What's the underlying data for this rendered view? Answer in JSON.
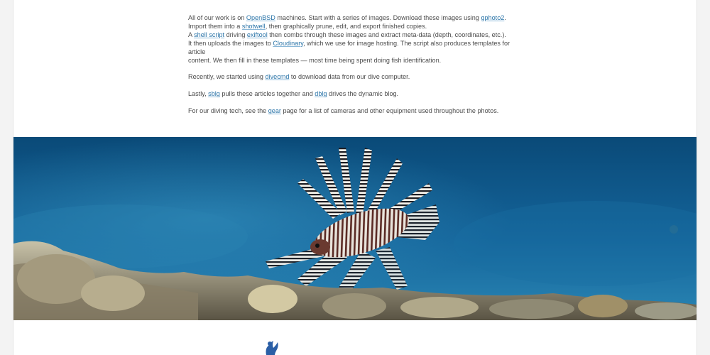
{
  "article": {
    "p1": {
      "l1": {
        "t1": "All of our work is on ",
        "link1": "OpenBSD",
        "t2": " machines. Start with a series of images. Download these images using ",
        "link2": "gphoto2",
        "t3": "."
      },
      "l2": {
        "t1": "Import them into a ",
        "link1": "shotwell",
        "t2": ", then graphically prune, edit, and export finished copies."
      },
      "l3": {
        "t1": "A ",
        "link1": "shell script",
        "t2": " driving ",
        "link2": "exiftool",
        "t3": " then combs through these images and extract meta-data (depth, coordinates, etc.)."
      },
      "l4": {
        "t1": "It then uploads the images to ",
        "link1": "Cloudinary",
        "t2": ", which we use for image hosting. The script also produces templates for article"
      },
      "l5": {
        "t1": "content. We then fill in these templates — most time being spent doing fish identification."
      }
    },
    "p2": {
      "t1": "Recently, we started using ",
      "link1": "divecmd",
      "t2": " to download data from our dive computer."
    },
    "p3": {
      "t1": "Lastly, ",
      "link1": "sblg",
      "t2": " pulls these articles together and ",
      "link2": "dblg",
      "t3": " drives the dynamic blog."
    },
    "p4": {
      "t1": "For our diving tech, see the ",
      "link1": "gear",
      "t2": " page for a list of cameras and other equipment used throughout the photos."
    }
  },
  "colors": {
    "link": "#2a74a8",
    "text": "#4b4b4b",
    "water_dark": "#0b4f7d",
    "water_light": "#2d8cb8"
  },
  "icons": {
    "footer_logo": "diver-logo-icon"
  }
}
